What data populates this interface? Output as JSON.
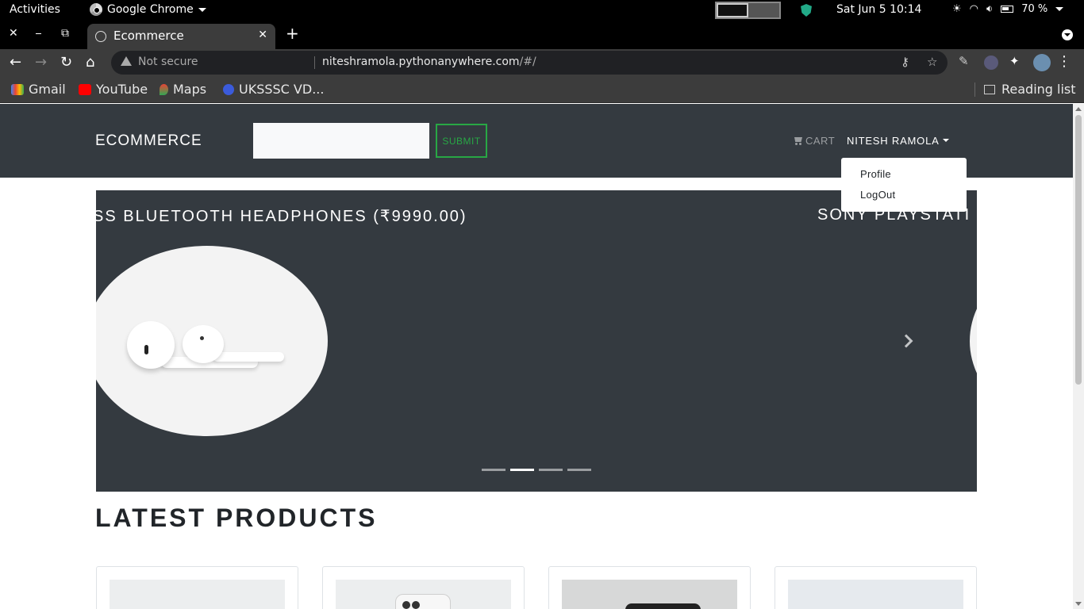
{
  "os": {
    "activities": "Activities",
    "app_name": "Google Chrome",
    "clock": "Sat Jun 5  10:14",
    "battery": "70 %"
  },
  "browser": {
    "tab_title": "Ecommerce",
    "not_secure": "Not secure",
    "url_host": "niteshramola.pythonanywhere.com",
    "url_path": "/#/",
    "bookmarks": [
      "Gmail",
      "YouTube",
      "Maps",
      "UKSSSC VD..."
    ],
    "reading_list": "Reading list"
  },
  "site": {
    "brand": "ECOMMERCE",
    "search_placeholder": "",
    "submit_label": "SUBMIT",
    "cart_label": "CART",
    "user_name": "NITESH RAMOLA",
    "dropdown": [
      "Profile",
      "LogOut"
    ],
    "carousel": {
      "current_title": "SS BLUETOOTH HEADPHONES (₹9990.00)",
      "next_title": "SONY PLAYSTATI",
      "slide_count": 4,
      "active_index": 1
    },
    "section_title": "LATEST PRODUCTS"
  },
  "colors": {
    "navbar": "#343a40",
    "accent_green": "#28a745"
  }
}
